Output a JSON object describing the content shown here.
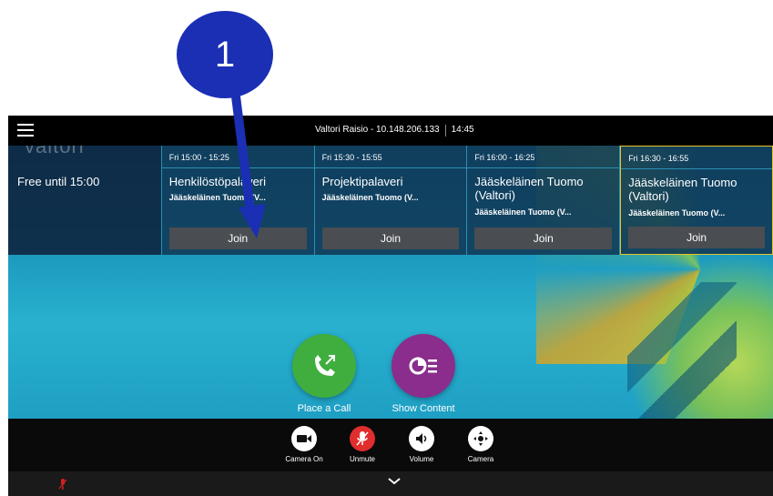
{
  "step_marker": {
    "number": "1"
  },
  "topbar": {
    "menu_icon": "hamburger-menu-icon",
    "system_name": "Valtori Raisio - 10.148.206.133",
    "time": "14:45"
  },
  "logo": {
    "text": "valtori"
  },
  "free_status": "Free until 15:00",
  "meetings": [
    {
      "time": "Fri 15:00 - 15:25",
      "title": "Henkilöstöpalaveri",
      "organizer": "Jääskeläinen Tuomo (V...",
      "join_label": "Join"
    },
    {
      "time": "Fri 15:30 - 15:55",
      "title": "Projektipalaveri",
      "organizer": "Jääskeläinen Tuomo (V...",
      "join_label": "Join"
    },
    {
      "time": "Fri 16:00 - 16:25",
      "title": "Jääskeläinen Tuomo (Valtori)",
      "organizer": "Jääskeläinen Tuomo (V...",
      "join_label": "Join"
    },
    {
      "time": "Fri 16:30 - 16:55",
      "title": "Jääskeläinen Tuomo (Valtori)",
      "organizer": "Jääskeläinen Tuomo (V...",
      "join_label": "Join"
    }
  ],
  "actions": {
    "place_call": {
      "label": "Place a Call",
      "icon": "phone-outgoing-icon",
      "color": "#3fae3f"
    },
    "show_content": {
      "label": "Show Content",
      "icon": "share-content-icon",
      "color": "#8a2d8c"
    }
  },
  "controls": [
    {
      "label": "Camera On",
      "icon": "camera-icon",
      "color": "#ffffff"
    },
    {
      "label": "Unmute",
      "icon": "mic-muted-icon",
      "color": "#e02d2d"
    },
    {
      "label": "Volume",
      "icon": "volume-icon",
      "color": "#ffffff"
    },
    {
      "label": "Camera",
      "icon": "camera-control-icon",
      "color": "#ffffff"
    }
  ],
  "status": {
    "mic_indicator_icon": "mic-muted-small-icon",
    "expand_icon": "chevron-down-icon"
  }
}
